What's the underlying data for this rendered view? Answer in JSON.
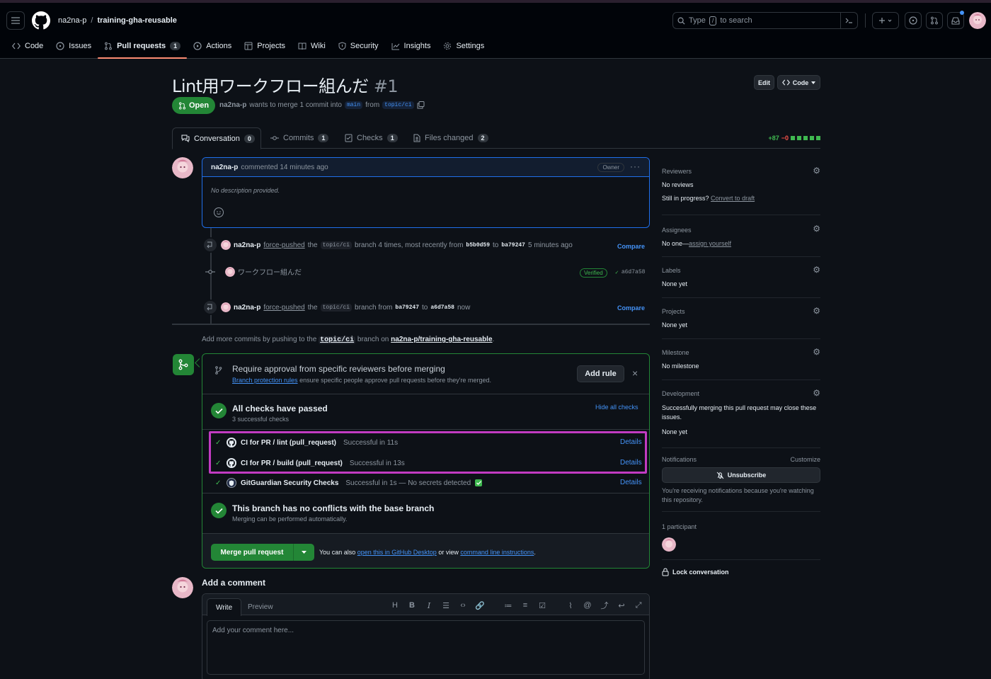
{
  "header": {
    "owner": "na2na-p",
    "separator": "/",
    "repo": "training-gha-reusable",
    "search_prefix": "Type",
    "search_key": "/",
    "search_suffix": "to search"
  },
  "repo_nav": [
    {
      "label": "Code",
      "icon": "code-icon"
    },
    {
      "label": "Issues",
      "icon": "issue-icon"
    },
    {
      "label": "Pull requests",
      "icon": "pull-request-icon",
      "count": "1",
      "active": true
    },
    {
      "label": "Actions",
      "icon": "play-icon"
    },
    {
      "label": "Projects",
      "icon": "table-icon"
    },
    {
      "label": "Wiki",
      "icon": "book-icon"
    },
    {
      "label": "Security",
      "icon": "shield-icon"
    },
    {
      "label": "Insights",
      "icon": "graph-icon"
    },
    {
      "label": "Settings",
      "icon": "gear-icon"
    }
  ],
  "pr": {
    "title": "Lint用ワークフロー組んだ",
    "number": "#1",
    "edit_label": "Edit",
    "code_label": "Code",
    "state": "Open",
    "author": "na2na-p",
    "merge_text": "wants to merge 1 commit into",
    "base": "main",
    "from_text": "from",
    "head": "topic/ci"
  },
  "tabs": [
    {
      "label": "Conversation",
      "count": "0"
    },
    {
      "label": "Commits",
      "count": "1"
    },
    {
      "label": "Checks",
      "count": "1"
    },
    {
      "label": "Files changed",
      "count": "2"
    }
  ],
  "diffstat": {
    "additions": "+87",
    "deletions": "−0"
  },
  "comment": {
    "author": "na2na-p",
    "meta": "commented 14 minutes ago",
    "badge": "Owner",
    "body": "No description provided."
  },
  "events": {
    "e1": {
      "user": "na2na-p",
      "action": "force-pushed",
      "the": "the",
      "branch": "topic/ci",
      "text": "branch 4 times, most recently from",
      "from_sha": "b5b0d59",
      "to": "to",
      "to_sha": "ba79247",
      "time": "5 minutes ago",
      "compare": "Compare"
    },
    "commit": {
      "message": "ワークフロー組んだ",
      "verified": "Verified",
      "sha": "a6d7a58"
    },
    "e2": {
      "user": "na2na-p",
      "action": "force-pushed",
      "the": "the",
      "branch": "topic/ci",
      "text": "branch from",
      "from_sha": "ba79247",
      "to": "to",
      "to_sha": "a6d7a58",
      "time": "now",
      "compare": "Compare"
    }
  },
  "add_more": {
    "prefix": "Add more commits by pushing to the",
    "branch": "topic/ci",
    "mid": "branch on",
    "repo": "na2na-p/training-gha-reusable",
    "suffix": "."
  },
  "merge_box": {
    "rule_title": "Require approval from specific reviewers before merging",
    "rule_link": "Branch protection rules",
    "rule_sub": "ensure specific people approve pull requests before they're merged.",
    "add_rule": "Add rule",
    "checks_title": "All checks have passed",
    "checks_sub": "3 successful checks",
    "hide_checks": "Hide all checks",
    "checks": [
      {
        "name": "CI for PR / lint (pull_request)",
        "status": "Successful in 11s",
        "details": "Details"
      },
      {
        "name": "CI for PR / build (pull_request)",
        "status": "Successful in 13s",
        "details": "Details"
      },
      {
        "name": "GitGuardian Security Checks",
        "status": "Successful in 1s — No secrets detected",
        "details": "Details"
      }
    ],
    "conflict_title": "This branch has no conflicts with the base branch",
    "conflict_sub": "Merging can be performed automatically.",
    "merge_button": "Merge pull request",
    "also_prefix": "You can also",
    "also_link1": "open this in GitHub Desktop",
    "also_mid": "or view",
    "also_link2": "command line instructions",
    "also_suffix": "."
  },
  "add_comment": {
    "title": "Add a comment",
    "write": "Write",
    "preview": "Preview",
    "placeholder": "Add your comment here..."
  },
  "sidebar": {
    "reviewers_label": "Reviewers",
    "reviewers_value": "No reviews",
    "in_progress": "Still in progress?",
    "convert_draft": "Convert to draft",
    "assignees_label": "Assignees",
    "assignees_value": "No one—",
    "assign_yourself": "assign yourself",
    "labels_label": "Labels",
    "labels_value": "None yet",
    "projects_label": "Projects",
    "projects_value": "None yet",
    "milestone_label": "Milestone",
    "milestone_value": "No milestone",
    "development_label": "Development",
    "development_text": "Successfully merging this pull request may close these issues.",
    "development_value": "None yet",
    "notifications_label": "Notifications",
    "customize": "Customize",
    "unsubscribe": "Unsubscribe",
    "notif_reason": "You're receiving notifications because you're watching this repository.",
    "participants": "1 participant",
    "lock": "Lock conversation"
  },
  "colors": {
    "accent": "#4493f8",
    "success": "#238636",
    "highlight": "#c23bc2",
    "background": "#0d1117"
  }
}
